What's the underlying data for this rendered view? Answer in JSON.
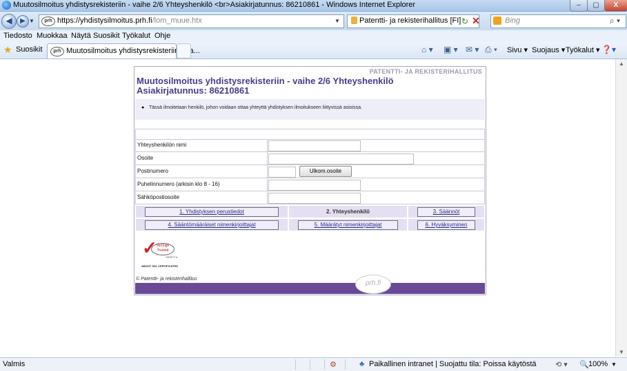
{
  "window": {
    "title": "Muutosilmoitus yhdistysrekisteriin - vaihe 2/6 Yhteyshenkilö <br>Asiakirjatunnus: 86210861 - Windows Internet Explorer",
    "minimize": "–",
    "maximize": "▢",
    "close": "X"
  },
  "address": {
    "url_host": "https://yhdistysilmoitus.prh.fi",
    "url_path": "/lom_muue.htx",
    "site_icon": "prh",
    "cert_text": "Patentti- ja rekisterihallitus [FI]",
    "search_placeholder": "Bing"
  },
  "menu": [
    "Tiedosto",
    "Muokkaa",
    "Näytä",
    "Suosikit",
    "Työkalut",
    "Ohje"
  ],
  "favorites": {
    "label": "Suosikit",
    "tab_title": "Muutosilmoitus yhdistysrekisteriin - va...",
    "commands": [
      "Sivu ▾",
      "Suojaus ▾",
      "Työkalut ▾"
    ]
  },
  "form": {
    "org_header": "PATENTTI- JA REKISTERIHALLITUS",
    "title_line1": "Muutosilmoitus yhdistysrekisteriin - vaihe 2/6 Yhteyshenkilö",
    "title_line2": "Asiakirjatunnus: 86210861",
    "info": "Tässä ilmoitetaan henkilö, johon voidaan ottaa yhteyttä yhdistyksen ilmoitukseen liittyvissä asioissa.",
    "fields": [
      {
        "label": "Yhteyshenkilön nimi",
        "value": ""
      },
      {
        "label": "Osoite",
        "value": ""
      },
      {
        "label": "Postinumero",
        "value": ""
      },
      {
        "label": "Puhelinnumero (arkisin klo 8 - 16)",
        "value": ""
      },
      {
        "label": "Sähköpostiosoite",
        "value": ""
      }
    ],
    "foreign_address_button": "Ulkom.osoite",
    "steps": [
      "1. Yhdistyksen perustiedot",
      "2. Yhteyshenkilö",
      "3. Säännöt",
      "4. Sääntömääräiset nimenkirjoittajat",
      "5. Määrätyt nimenkirjoittajat",
      "6. Hyväksyminen"
    ],
    "verisign_line1": "VeriSign",
    "verisign_line2": "Trusted",
    "verisign_verify": "VERIFY ▸",
    "ssl_about": "ABOUT SSL CERTIFICATES",
    "copyright": "© Patentti- ja rekisterihallitus",
    "footer_logo": "prh.fi"
  },
  "status": {
    "left": "Valmis",
    "zone": "Paikallinen intranet | Suojattu tila: Poissa käytöstä",
    "zoom": "100%"
  }
}
